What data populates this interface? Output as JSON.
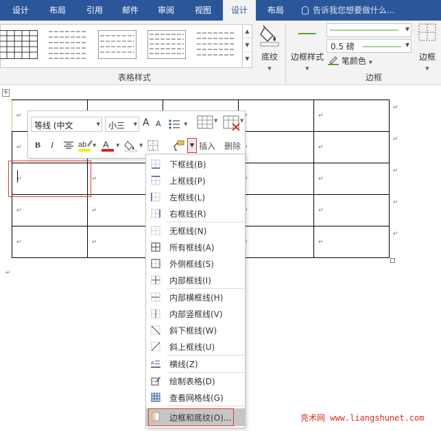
{
  "tabs": [
    "设计",
    "布局",
    "引用",
    "邮件",
    "审阅",
    "视图",
    "设计",
    "布局"
  ],
  "tell_me": "告诉我您想要做什么...",
  "ribbon": {
    "table_styles_label": "表格样式",
    "shading_label": "底纹",
    "border_styles_label": "边框样式",
    "line_weight": "0.5 磅",
    "pen_color_label": "笔颜色",
    "borders_label": "边框",
    "borders_group_label": "边框"
  },
  "mini_toolbar": {
    "font": "等线 (中文",
    "size": "小三",
    "grow": "A",
    "shrink": "A",
    "bold": "B",
    "italic": "I",
    "insert_label": "插入",
    "delete_label": "删除"
  },
  "paragraph_mark": "↵",
  "border_menu": [
    {
      "label": "下框线(B)",
      "icon": "bottom-border-icon"
    },
    {
      "label": "上框线(P)",
      "icon": "top-border-icon"
    },
    {
      "label": "左框线(L)",
      "icon": "left-border-icon"
    },
    {
      "label": "右框线(R)",
      "icon": "right-border-icon"
    },
    {
      "label": "无框线(N)",
      "icon": "no-border-icon"
    },
    {
      "label": "所有框线(A)",
      "icon": "all-borders-icon"
    },
    {
      "label": "外侧框线(S)",
      "icon": "outside-borders-icon"
    },
    {
      "label": "内部框线(I)",
      "icon": "inside-borders-icon"
    },
    {
      "label": "内部横框线(H)",
      "icon": "inside-horizontal-border-icon"
    },
    {
      "label": "内部竖框线(V)",
      "icon": "inside-vertical-border-icon"
    },
    {
      "label": "斜下框线(W)",
      "icon": "diagonal-down-border-icon"
    },
    {
      "label": "斜上框线(U)",
      "icon": "diagonal-up-border-icon"
    },
    {
      "label": "横线(Z)",
      "icon": "horizontal-line-icon"
    },
    {
      "label": "绘制表格(D)",
      "icon": "draw-table-icon"
    },
    {
      "label": "查看网格线(G)",
      "icon": "view-gridlines-icon"
    },
    {
      "label": "边框和底纹(O)...",
      "icon": "borders-and-shading-icon"
    }
  ],
  "watermark": "亮术网 www.liangshunet.com"
}
